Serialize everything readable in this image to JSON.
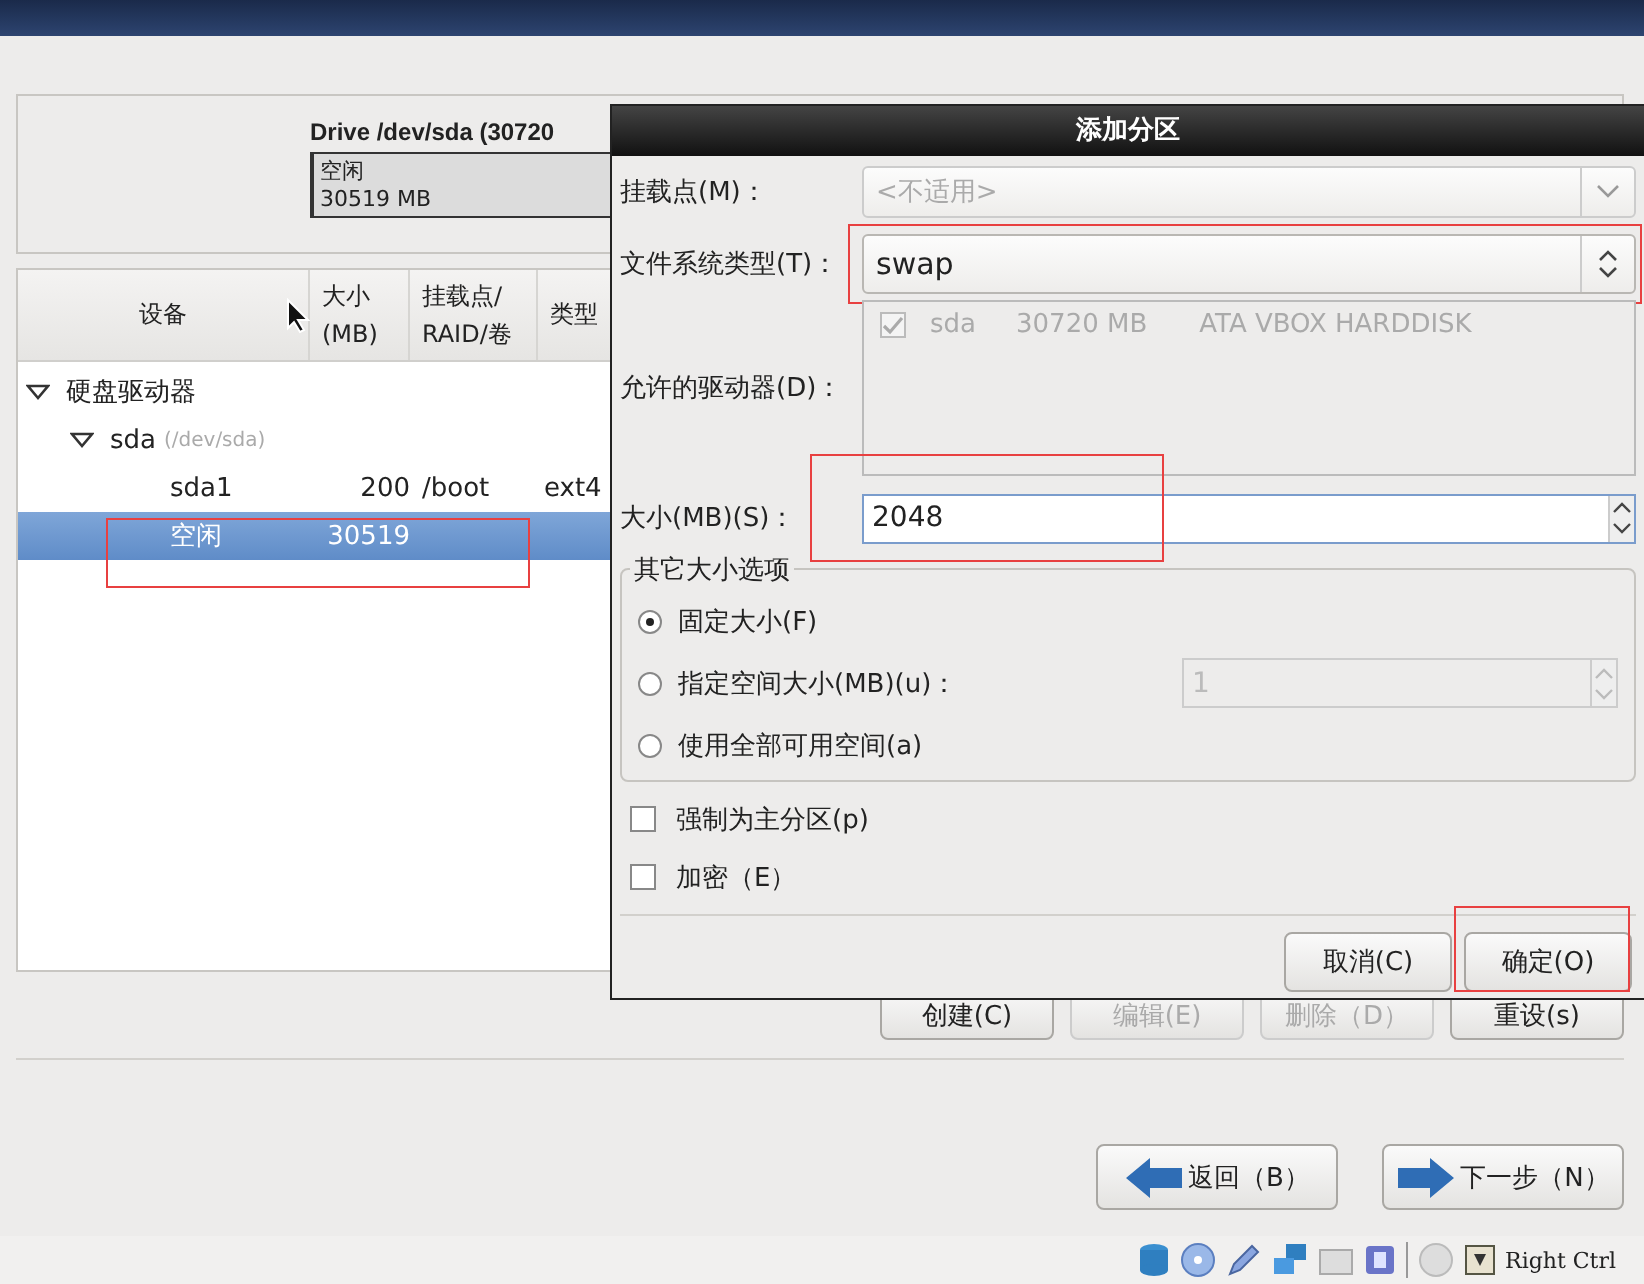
{
  "drive_panel": {
    "title": "Drive /dev/sda (30720",
    "segments": [
      {
        "name": "空闲",
        "size": "30519 MB"
      }
    ]
  },
  "tree": {
    "columns": [
      "设备",
      "大小\n(MB)",
      "挂载点/\nRAID/卷",
      "类型"
    ],
    "rows": [
      {
        "device": "硬盘驱动器",
        "expanded": true,
        "selected": false,
        "children": [
          {
            "device": "sda",
            "path": "(/dev/sda)",
            "expanded": true,
            "selected": false,
            "children": [
              {
                "device": "sda1",
                "size": "200",
                "mount": "/boot",
                "type": "ext4",
                "selected": false
              },
              {
                "device": "空闲",
                "size": "30519",
                "selected": true,
                "highlighted": true
              }
            ]
          }
        ]
      }
    ]
  },
  "tree_actions": [
    {
      "label": "创建(C)",
      "disabled": false
    },
    {
      "label": "编辑(E)",
      "disabled": true
    },
    {
      "label": "删除（D）",
      "disabled": true
    },
    {
      "label": "重设(s)",
      "disabled": false
    }
  ],
  "nav": [
    {
      "label": "返回（B）",
      "kind": "back"
    },
    {
      "label": "下一步（N）",
      "kind": "next"
    }
  ],
  "status_bar": {
    "text": "Right Ctrl"
  },
  "dialog": {
    "title": "添加分区",
    "mount_point": {
      "label": "挂载点(M)：",
      "value": "<不适用>",
      "disabled": true
    },
    "fs_type": {
      "label": "文件系统类型(T)：",
      "value": "swap",
      "highlighted": true
    },
    "drives": {
      "label": "允许的驱动器(D)：",
      "disabled": true,
      "items": [
        {
          "checked": true,
          "name": "sda",
          "size": "30720 MB",
          "model": "ATA VBOX HARDDISK"
        }
      ]
    },
    "size": {
      "label": "大小(MB)(S)：",
      "value": "2048",
      "highlighted": true
    },
    "size_options": {
      "title": "其它大小选项",
      "options": [
        {
          "label": "固定大小(F)",
          "selected": true,
          "kind": "plain"
        },
        {
          "label": "指定空间大小(MB)(u)：",
          "selected": false,
          "kind": "spin",
          "value": "1"
        },
        {
          "label": "使用全部可用空间(a)",
          "selected": false,
          "kind": "plain"
        }
      ]
    },
    "checkboxes": [
      {
        "label": "强制为主分区(p)",
        "checked": false
      },
      {
        "label": "加密（E）",
        "checked": false
      }
    ],
    "buttons": [
      {
        "label": "取消(C)",
        "highlighted": false
      },
      {
        "label": "确定(O)",
        "highlighted": true
      }
    ]
  }
}
